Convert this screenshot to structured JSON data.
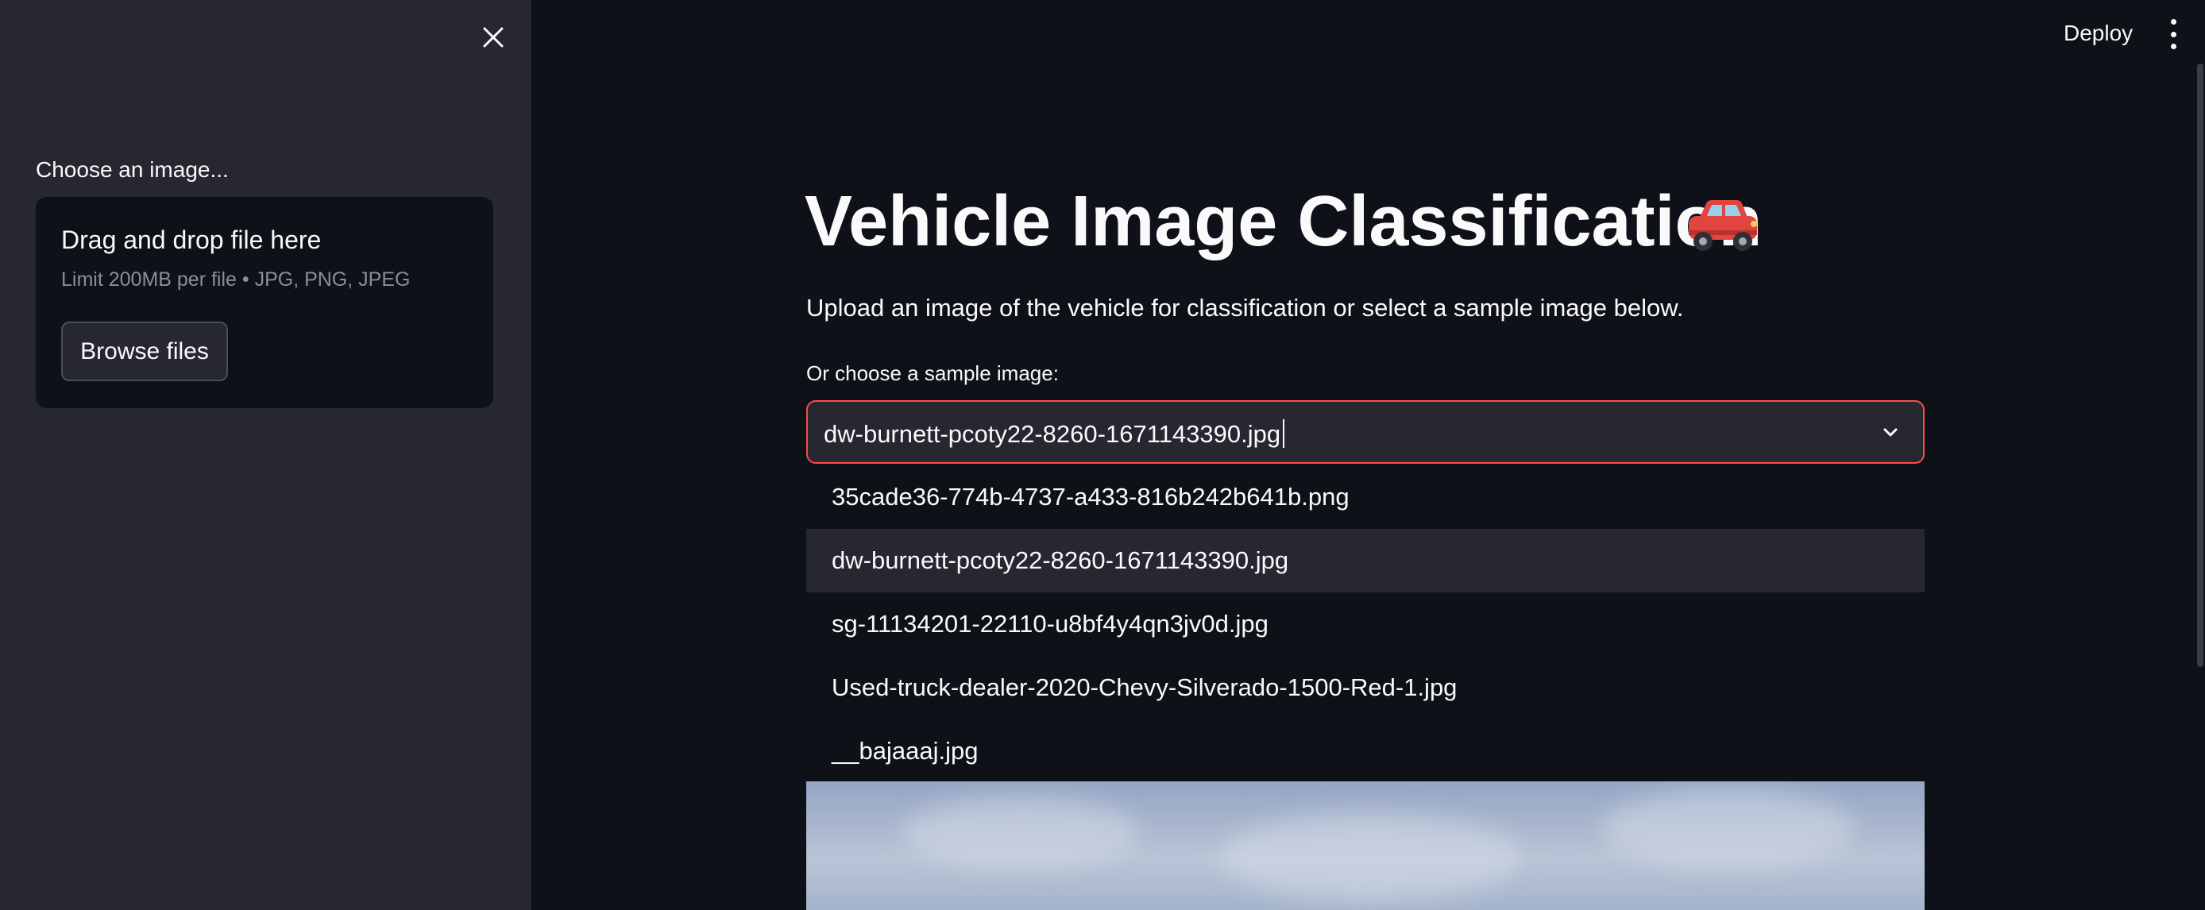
{
  "sidebar": {
    "uploader_label": "Choose an image...",
    "dropzone_title": "Drag and drop file here",
    "dropzone_limit": "Limit 200MB per file • JPG, PNG, JPEG",
    "browse_label": "Browse files"
  },
  "header": {
    "deploy_label": "Deploy"
  },
  "main": {
    "title": "Vehicle Image Classification",
    "subtitle": "Upload an image of the vehicle for classification or select a sample image below.",
    "select_label": "Or choose a sample image:",
    "select_value": "dw-burnett-pcoty22-8260-1671143390.jpg",
    "options": [
      "35cade36-774b-4737-a433-816b242b641b.png",
      "dw-burnett-pcoty22-8260-1671143390.jpg",
      "sg-11134201-22110-u8bf4y4qn3jv0d.jpg",
      "Used-truck-dealer-2020-Chevy-Silverado-1500-Red-1.jpg",
      "__bajaaaj.jpg"
    ],
    "selected_option_index": 1
  },
  "colors": {
    "background": "#0e1117",
    "sidebar": "#262730",
    "accent": "#ff4b4b",
    "text": "#fafafa",
    "muted_text": "#8b8d98"
  }
}
